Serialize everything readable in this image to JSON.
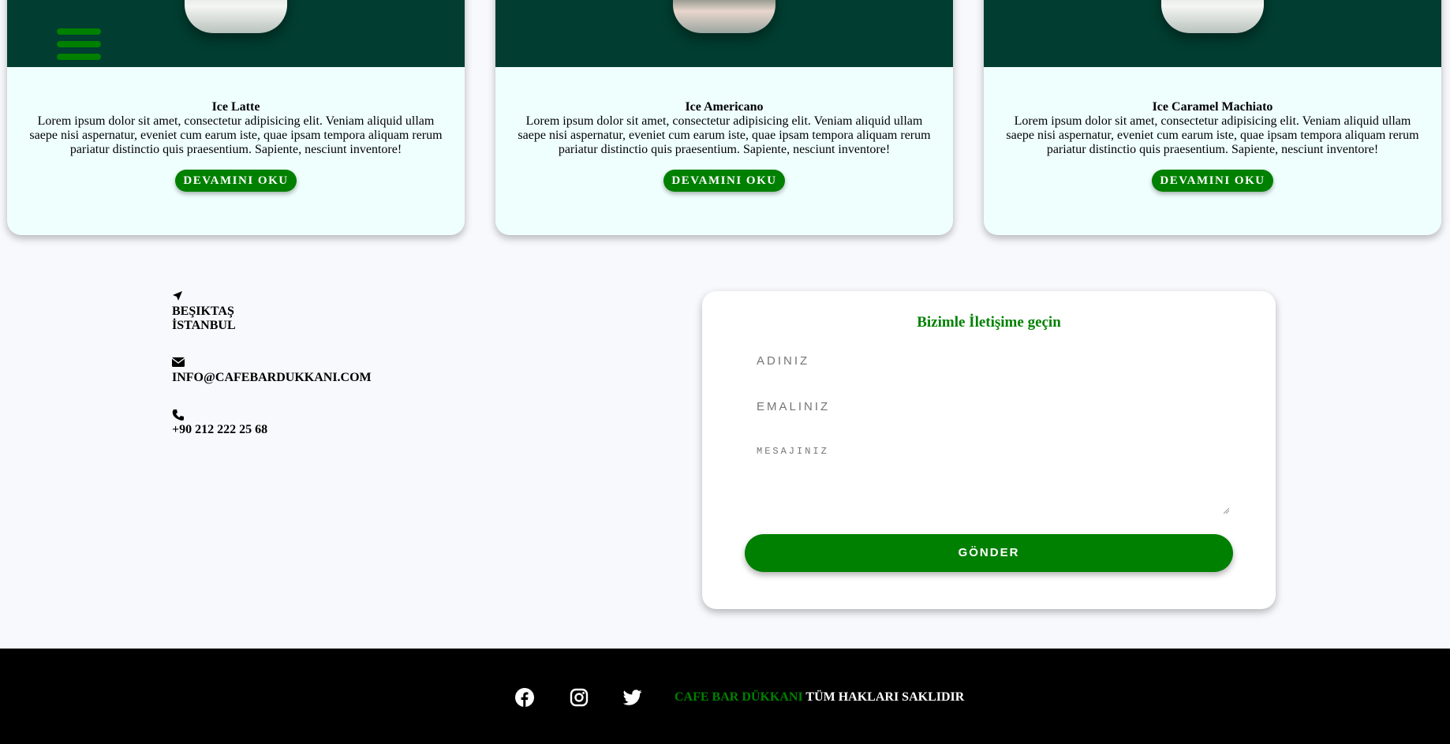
{
  "products": [
    {
      "title": "Ice Latte",
      "description": "Lorem ipsum dolor sit amet, consectetur adipisicing elit. Veniam aliquid ullam saepe nisi aspernatur, eveniet cum earum iste, quae ipsam tempora aliquam rerum pariatur distinctio quis praesentium. Sapiente, nesciunt inventore!",
      "button_label": "DEVAMINI OKU"
    },
    {
      "title": "Ice Americano",
      "description": "Lorem ipsum dolor sit amet, consectetur adipisicing elit. Veniam aliquid ullam saepe nisi aspernatur, eveniet cum earum iste, quae ipsam tempora aliquam rerum pariatur distinctio quis praesentium. Sapiente, nesciunt inventore!",
      "button_label": "DEVAMINI OKU"
    },
    {
      "title": "Ice Caramel Machiato",
      "description": "Lorem ipsum dolor sit amet, consectetur adipisicing elit. Veniam aliquid ullam saepe nisi aspernatur, eveniet cum earum iste, quae ipsam tempora aliquam rerum pariatur distinctio quis praesentium. Sapiente, nesciunt inventore!",
      "button_label": "DEVAMINI OKU"
    }
  ],
  "contact": {
    "location_icon": "location-arrow-icon",
    "address_line1": "BEŞIKTAŞ",
    "address_line2": "İSTANBUL",
    "email_icon": "envelope-icon",
    "email": "INFO@CAFEBARDUKKANI.COM",
    "phone_icon": "phone-icon",
    "phone": "+90 212 222 25 68"
  },
  "form": {
    "title": "Bizimle İletişime geçin",
    "name_placeholder": "ADINIZ",
    "email_placeholder": "EMALINIZ",
    "message_placeholder": "MESAJINIZ",
    "submit_label": "GÖNDER"
  },
  "footer": {
    "social_icons": [
      "facebook-icon",
      "instagram-icon",
      "twitter-icon"
    ],
    "brand": "CAFE BAR DÜKKANI",
    "rights": "TÜM HAKLARI SAKLIDIR"
  },
  "colors": {
    "accent": "#008000",
    "card_header": "#013d30",
    "card_bg": "#effffe",
    "footer_bg": "#000000"
  }
}
